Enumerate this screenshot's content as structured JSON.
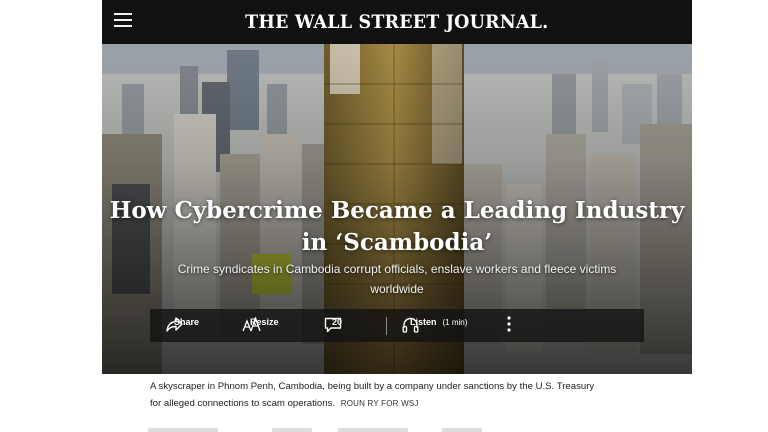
{
  "masthead": {
    "logo": "THE WALL STREET JOURNAL."
  },
  "hero": {
    "headline_line1": "How Cybercrime Became a Leading Industry",
    "headline_line2": "in ‘Scambodia’",
    "dek_line1": "Crime syndicates in Cambodia corrupt officials, enslave workers and fleece victims",
    "dek_line2": "worldwide"
  },
  "toolbar": {
    "share_label": "Share",
    "resize_label": "Resize",
    "comments_count": "20",
    "listen_label": "Listen",
    "listen_duration": "(1 min)"
  },
  "caption": {
    "line1": "A skyscraper in Phnom Penh, Cambodia, being built by a company under sanctions by the U.S. Treasury",
    "line2": "for alleged connections to scam operations.",
    "credit": "ROUN RY FOR WSJ"
  },
  "icons": {
    "menu": "hamburger-menu-icon",
    "share": "share-arrow-icon",
    "resize": "text-resize-icon",
    "comments": "speech-bubble-icon",
    "listen": "headphones-icon",
    "more": "vertical-ellipsis-icon"
  },
  "colors": {
    "masthead_bg": "#111111",
    "toolbar_bg": "#121212",
    "caption_text": "#222222"
  }
}
